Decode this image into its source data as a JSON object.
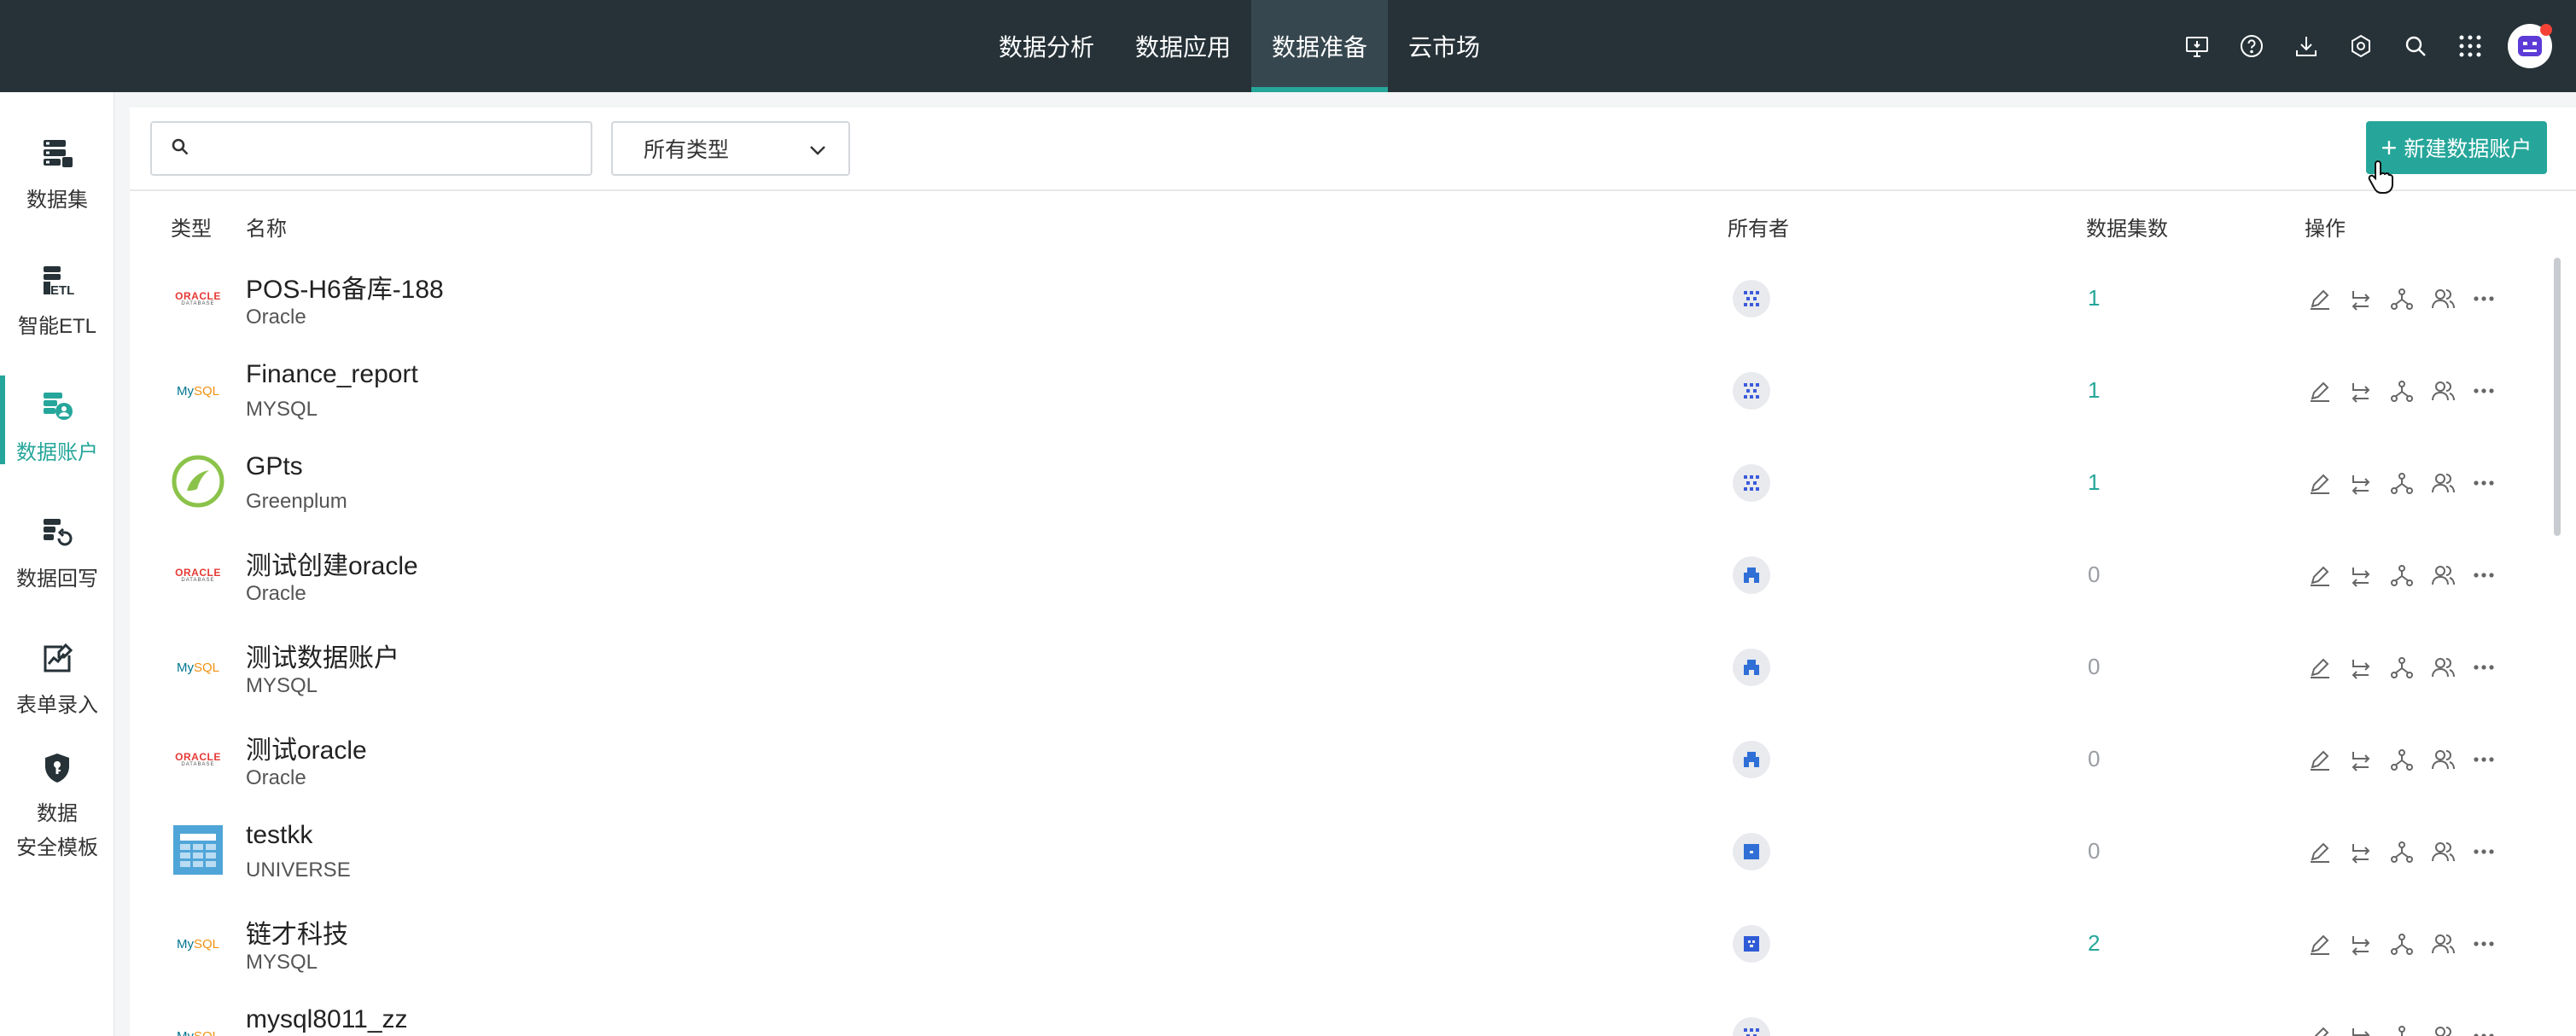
{
  "topnav": {
    "tabs": [
      {
        "label": "数据分析",
        "active": false
      },
      {
        "label": "数据应用",
        "active": false
      },
      {
        "label": "数据准备",
        "active": true
      },
      {
        "label": "云市场",
        "active": false
      }
    ],
    "icons": [
      "monitor-icon",
      "help-icon",
      "download-icon",
      "settings-icon",
      "search-icon",
      "apps-grid-icon",
      "user-avatar"
    ]
  },
  "sidebar": {
    "items": [
      {
        "label": "数据集",
        "icon": "dataset-icon",
        "active": false
      },
      {
        "label": "智能ETL",
        "icon": "etl-icon",
        "active": false
      },
      {
        "label": "数据账户",
        "icon": "data-account-icon",
        "active": true
      },
      {
        "label": "数据回写",
        "icon": "data-writeback-icon",
        "active": false
      },
      {
        "label": "表单录入",
        "icon": "form-entry-icon",
        "active": false
      },
      {
        "label_line1": "数据",
        "label_line2": "安全模板",
        "icon": "security-template-icon",
        "active": false
      }
    ]
  },
  "toolbar": {
    "search_placeholder": "",
    "type_filter": "所有类型",
    "new_button": "新建数据账户"
  },
  "table": {
    "headers": {
      "type": "类型",
      "name": "名称",
      "owner": "所有者",
      "dataset_count": "数据集数",
      "actions": "操作"
    },
    "rows": [
      {
        "name": "POS-H6备库-188",
        "type": "Oracle",
        "logo": "oracle",
        "count": "1"
      },
      {
        "name": "Finance_report",
        "type": "MYSQL",
        "logo": "mysql",
        "count": "1"
      },
      {
        "name": "GPts",
        "type": "Greenplum",
        "logo": "greenplum",
        "count": "1"
      },
      {
        "name": "测试创建oracle",
        "type": "Oracle",
        "logo": "oracle",
        "count": "0"
      },
      {
        "name": "测试数据账户",
        "type": "MYSQL",
        "logo": "mysql",
        "count": "0"
      },
      {
        "name": "测试oracle",
        "type": "Oracle",
        "logo": "oracle",
        "count": "0"
      },
      {
        "name": "testkk",
        "type": "UNIVERSE",
        "logo": "universe",
        "count": "0"
      },
      {
        "name": "链才科技",
        "type": "MYSQL",
        "logo": "mysql",
        "count": "2"
      },
      {
        "name": "mysql8011_zz",
        "type": "",
        "logo": "mysql",
        "count": ""
      }
    ],
    "action_icons": [
      "edit-icon",
      "switch-icon",
      "lineage-icon",
      "users-icon",
      "more-icon"
    ]
  },
  "logos": {
    "oracle_line1": "ORACLE",
    "oracle_line2": "DATABASE",
    "mysql_a": "My",
    "mysql_b": "SQL"
  },
  "colors": {
    "accent": "#26a69a",
    "topbar": "#263238"
  }
}
